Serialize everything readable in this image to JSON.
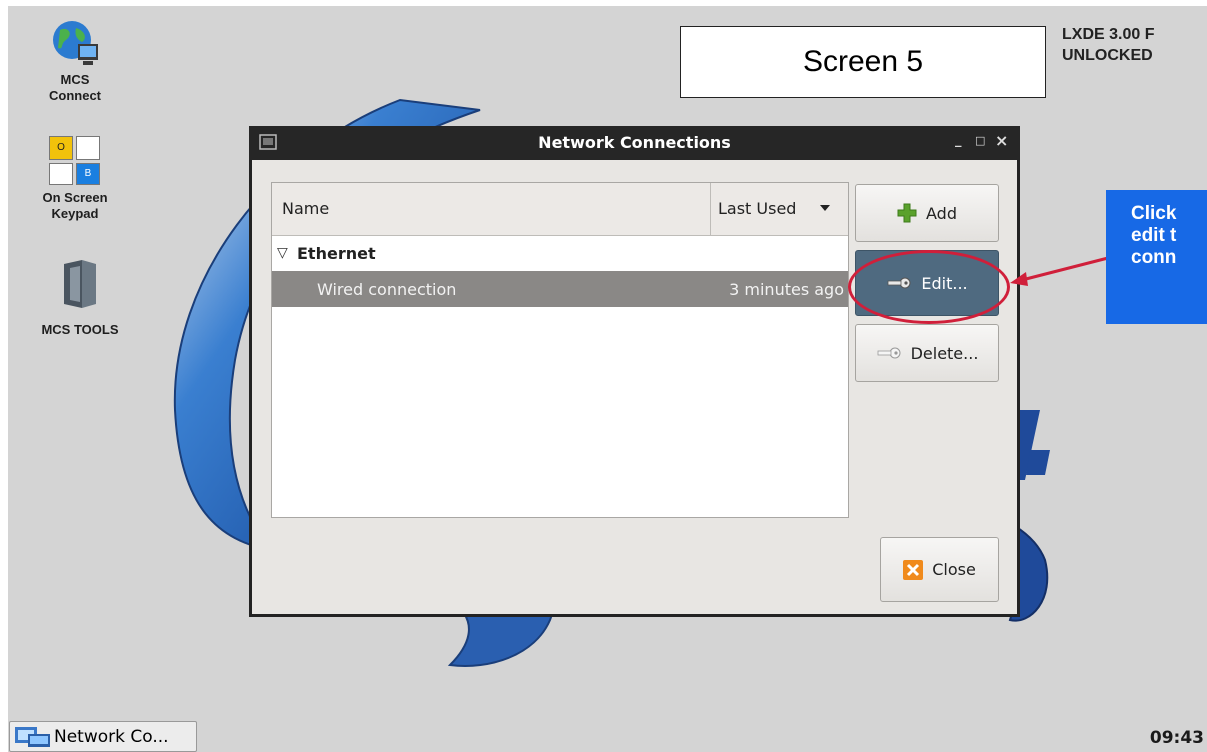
{
  "desktop_icons": [
    {
      "label_line1": "MCS",
      "label_line2": "Connect",
      "icon": "globe-computer-icon"
    },
    {
      "label_line1": "On Screen",
      "label_line2": "Keypad",
      "icon": "keypad-icon",
      "keys": [
        "O",
        "B"
      ]
    },
    {
      "label_line1": "MCS TOOLS",
      "icon": "folder-icon"
    }
  ],
  "screen_label": "Screen 5",
  "system_status": {
    "line1": "LXDE 3.00 F",
    "line2": "UNLOCKED"
  },
  "window": {
    "title": "Network Connections",
    "controls": {
      "minimize": "_",
      "maximize": "□",
      "close": "×"
    }
  },
  "list": {
    "columns": {
      "name": "Name",
      "last_used": "Last Used"
    },
    "groups": [
      {
        "label": "Ethernet",
        "connections": [
          {
            "name": "Wired connection",
            "last_used": "3 minutes ago",
            "selected": true
          }
        ]
      }
    ]
  },
  "buttons": {
    "add": "Add",
    "edit": "Edit...",
    "delete": "Delete...",
    "close": "Close"
  },
  "annotation": {
    "callout_lines": [
      "Click",
      "edit t",
      "conn"
    ],
    "color": "#1769e6",
    "highlight_color": "#d01f3a"
  },
  "taskbar": {
    "task_label": "Network Co...",
    "clock": "09:43"
  },
  "colors": {
    "desktop": "#d4d4d4",
    "titlebar": "#262626",
    "selected_row": "#8a8886",
    "edit_button": "#4f6a80"
  }
}
